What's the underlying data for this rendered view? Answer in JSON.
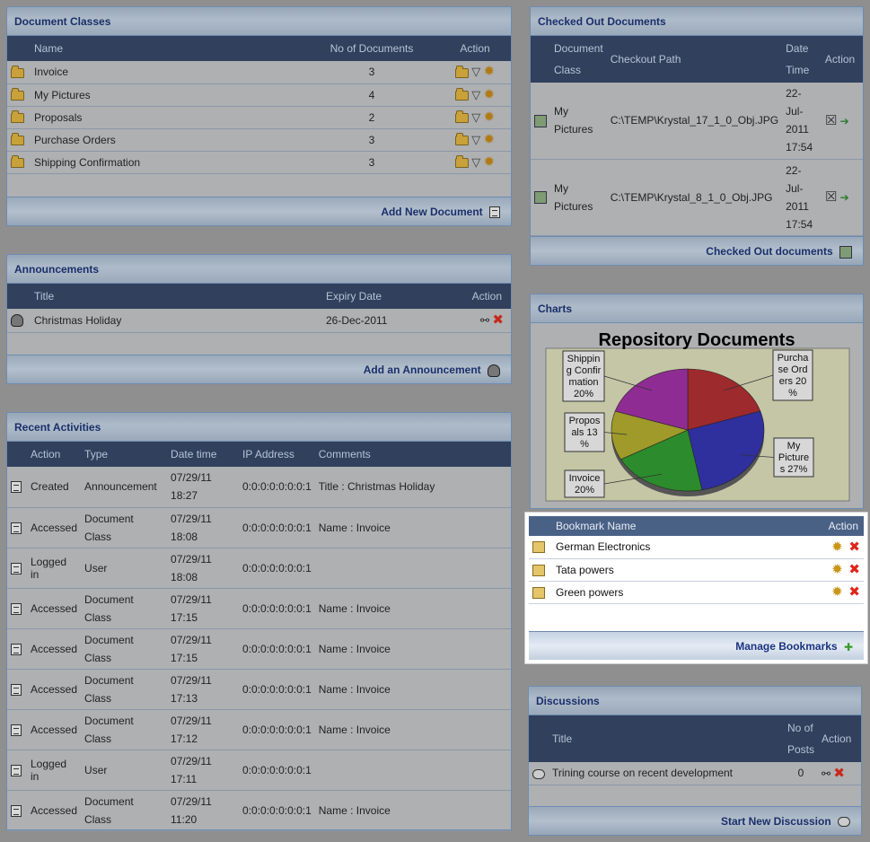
{
  "document_classes": {
    "title": "Document Classes",
    "headers": {
      "name": "Name",
      "count": "No of Documents",
      "action": "Action"
    },
    "rows": [
      {
        "name": "Invoice",
        "count": "3"
      },
      {
        "name": "My Pictures",
        "count": "4"
      },
      {
        "name": "Proposals",
        "count": "2"
      },
      {
        "name": "Purchase Orders",
        "count": "3"
      },
      {
        "name": "Shipping Confirmation",
        "count": "3"
      }
    ],
    "footer_link": "Add New Document"
  },
  "announcements": {
    "title": "Announcements",
    "headers": {
      "title": "Title",
      "expiry": "Expiry Date",
      "action": "Action"
    },
    "rows": [
      {
        "title": "Christmas Holiday",
        "expiry": "26-Dec-2011"
      }
    ],
    "footer_link": "Add an Announcement"
  },
  "recent_activities": {
    "title": "Recent Activities",
    "headers": {
      "action": "Action",
      "type": "Type",
      "datetime": "Date time",
      "ip": "IP Address",
      "comments": "Comments"
    },
    "rows": [
      {
        "action": "Created",
        "type": "Announcement",
        "date": "07/29/11",
        "time": "18:27",
        "ip": "0:0:0:0:0:0:0:1",
        "comments": "Title : Christmas Holiday"
      },
      {
        "action": "Accessed",
        "type": "Document Class",
        "date": "07/29/11",
        "time": "18:08",
        "ip": "0:0:0:0:0:0:0:1",
        "comments": "Name : Invoice"
      },
      {
        "action": "Logged in",
        "type": "User",
        "date": "07/29/11",
        "time": "18:08",
        "ip": "0:0:0:0:0:0:0:1",
        "comments": ""
      },
      {
        "action": "Accessed",
        "type": "Document Class",
        "date": "07/29/11",
        "time": "17:15",
        "ip": "0:0:0:0:0:0:0:1",
        "comments": "Name : Invoice"
      },
      {
        "action": "Accessed",
        "type": "Document Class",
        "date": "07/29/11",
        "time": "17:15",
        "ip": "0:0:0:0:0:0:0:1",
        "comments": "Name : Invoice"
      },
      {
        "action": "Accessed",
        "type": "Document Class",
        "date": "07/29/11",
        "time": "17:13",
        "ip": "0:0:0:0:0:0:0:1",
        "comments": "Name : Invoice"
      },
      {
        "action": "Accessed",
        "type": "Document Class",
        "date": "07/29/11",
        "time": "17:12",
        "ip": "0:0:0:0:0:0:0:1",
        "comments": "Name : Invoice"
      },
      {
        "action": "Logged in",
        "type": "User",
        "date": "07/29/11",
        "time": "17:11",
        "ip": "0:0:0:0:0:0:0:1",
        "comments": ""
      },
      {
        "action": "Accessed",
        "type": "Document Class",
        "date": "07/29/11",
        "time": "11:20",
        "ip": "0:0:0:0:0:0:0:1",
        "comments": "Name : Invoice"
      }
    ]
  },
  "checked_out": {
    "title": "Checked Out Documents",
    "headers": {
      "doc_class": "Document Class",
      "path": "Checkout Path",
      "datetime": "Date Time",
      "action": "Action"
    },
    "rows": [
      {
        "doc_class": "My Pictures",
        "path": "C:\\TEMP\\Krystal_17_1_0_Obj.JPG",
        "datetime": "22-Jul-2011 17:54"
      },
      {
        "doc_class": "My Pictures",
        "path": "C:\\TEMP\\Krystal_8_1_0_Obj.JPG",
        "datetime": "22-Jul-2011 17:54"
      }
    ],
    "footer_link": "Checked Out documents"
  },
  "charts": {
    "title": "Charts",
    "chart_title": "Repository Documents"
  },
  "chart_data": {
    "type": "pie",
    "title": "Repository Documents",
    "slices": [
      {
        "label": "Purchase Orders",
        "value": 20,
        "color": "#9d2a2c"
      },
      {
        "label": "My Pictures",
        "value": 27,
        "color": "#2f2f9e"
      },
      {
        "label": "Invoice",
        "value": 20,
        "color": "#2c8b2c"
      },
      {
        "label": "Proposals",
        "value": 13,
        "color": "#9f9a2a"
      },
      {
        "label": "Shipping Confirmation",
        "value": 20,
        "color": "#8f2c93"
      }
    ],
    "label_texts": [
      [
        "Purcha",
        "se Ord",
        "ers 20",
        "%"
      ],
      [
        "My",
        "Picture",
        "s 27%"
      ],
      [
        "Invoice",
        "20%"
      ],
      [
        "Propos",
        "als 13",
        "%"
      ],
      [
        "Shippin",
        "g Confir",
        "mation",
        "20%"
      ]
    ]
  },
  "bookmarks": {
    "headers": {
      "name": "Bookmark Name",
      "action": "Action"
    },
    "rows": [
      {
        "name": "German Electronics"
      },
      {
        "name": "Tata powers"
      },
      {
        "name": "Green powers"
      }
    ],
    "footer_link": "Manage Bookmarks"
  },
  "discussions": {
    "title": "Discussions",
    "headers": {
      "title": "Title",
      "posts": "No of Posts",
      "action": "Action"
    },
    "rows": [
      {
        "title": "Trining course on recent development",
        "posts": "0"
      }
    ],
    "footer_link": "Start New Discussion"
  },
  "colors": {
    "header_bg": "#31405c",
    "title_text": "#1a2f6a",
    "delete": "#c8281c",
    "gear": "#b07a16"
  }
}
